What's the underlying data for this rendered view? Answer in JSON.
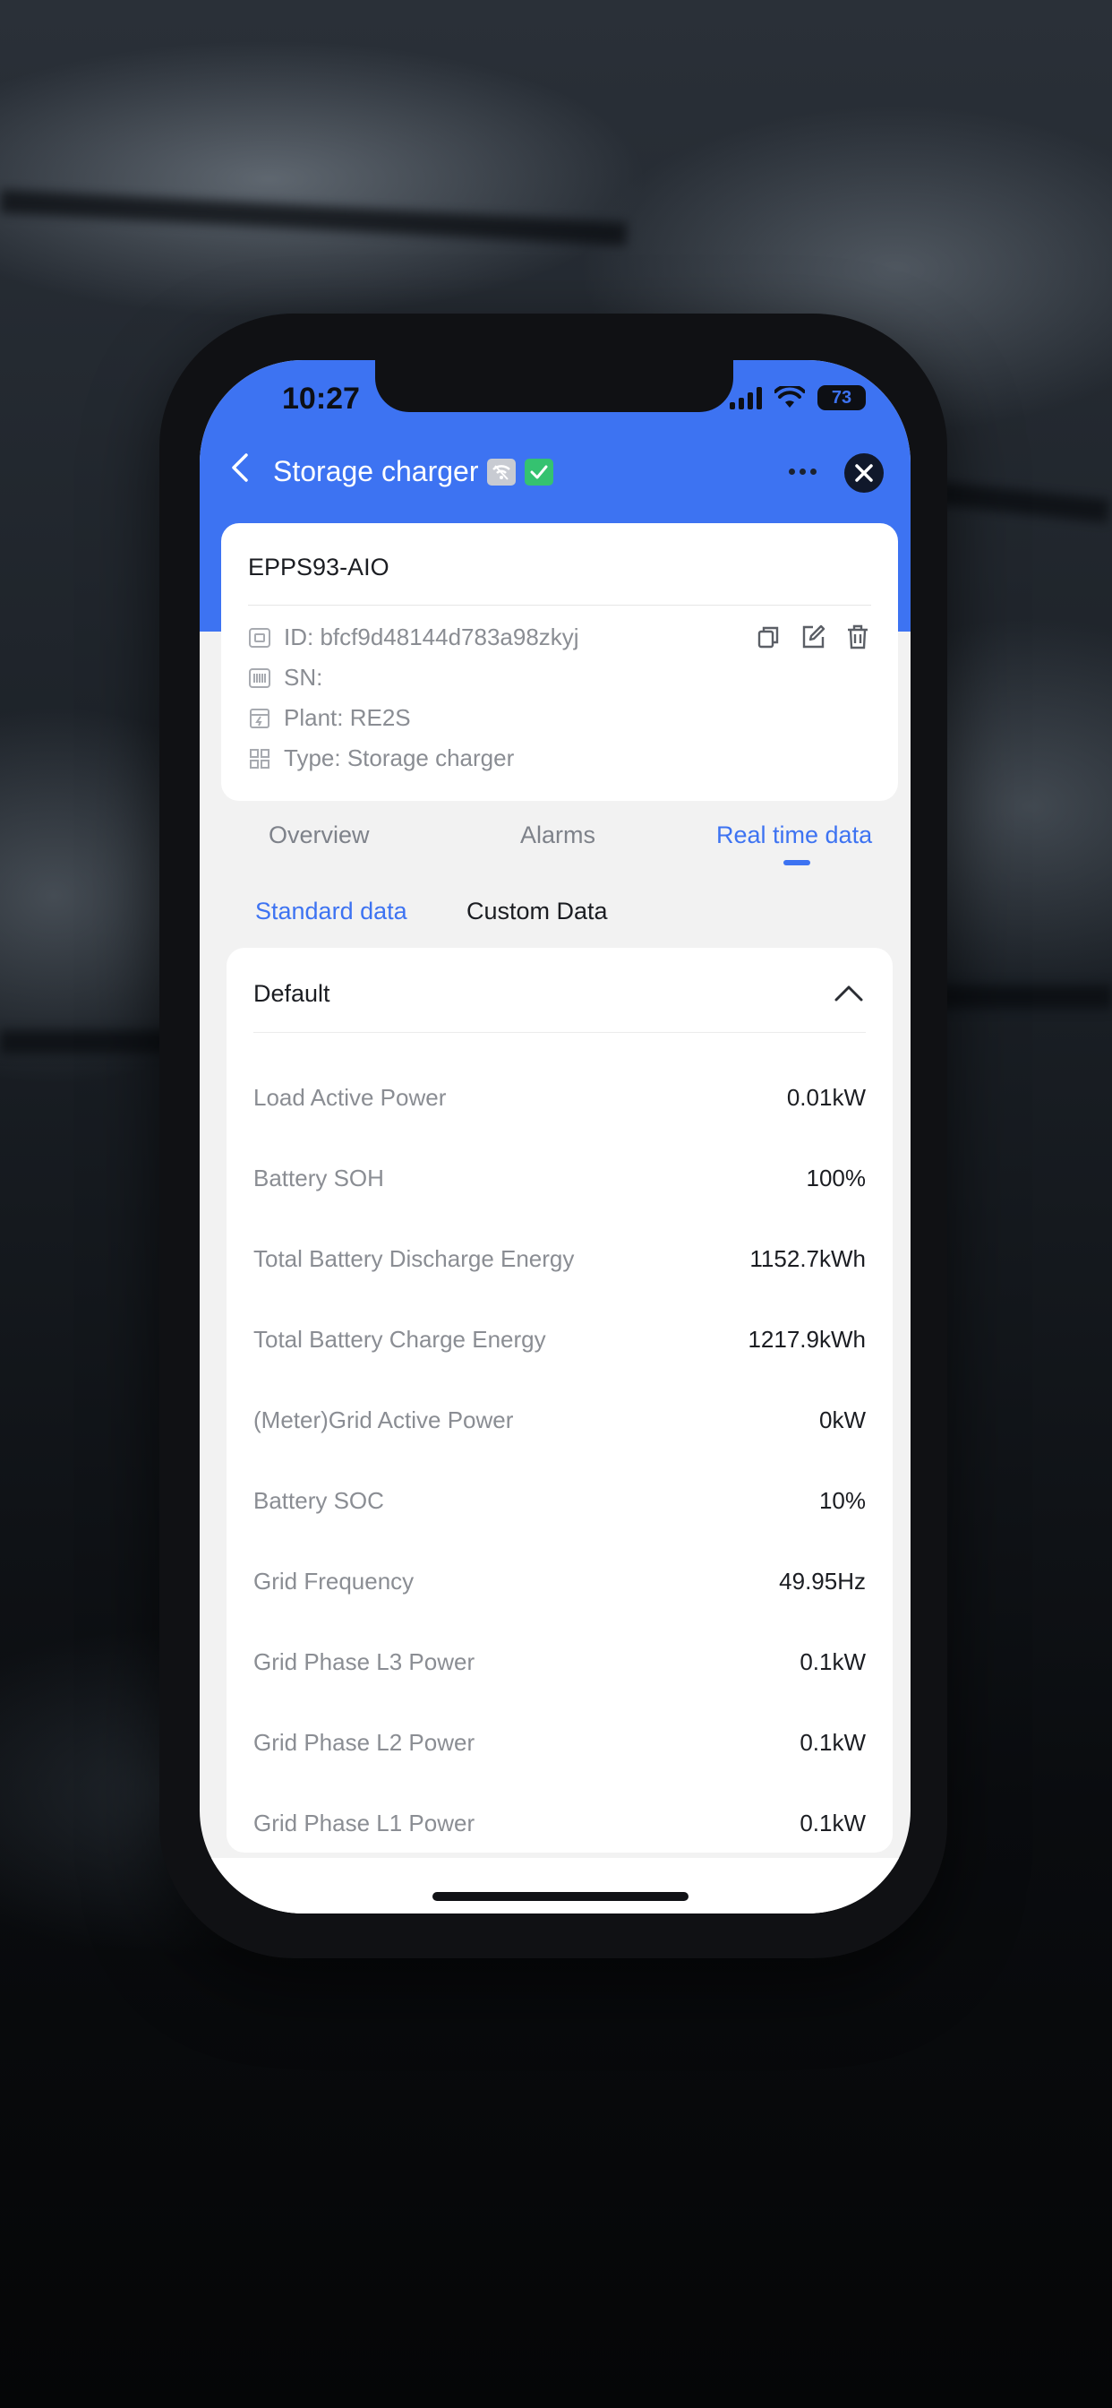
{
  "status_bar": {
    "time": "10:27",
    "battery": "73"
  },
  "nav": {
    "title": "Storage charger",
    "wifi_badge_icon": "wifi-off-icon",
    "status_badge_icon": "check-icon"
  },
  "device": {
    "name": "EPPS93-AIO",
    "id": "ID: bfcf9d48144d783a98zkyj",
    "sn": "SN:",
    "plant": "Plant: RE2S",
    "type": "Type: Storage charger"
  },
  "tabs": [
    {
      "label": "Overview",
      "active": false
    },
    {
      "label": "Alarms",
      "active": false
    },
    {
      "label": "Real time data",
      "active": true
    }
  ],
  "subtabs": [
    {
      "label": "Standard data",
      "active": true
    },
    {
      "label": "Custom Data",
      "active": false
    }
  ],
  "section": {
    "title": "Default",
    "rows": [
      {
        "label": "Load Active Power",
        "value": "0.01kW"
      },
      {
        "label": "Battery SOH",
        "value": "100%"
      },
      {
        "label": "Total Battery Discharge Energy",
        "value": "1152.7kWh"
      },
      {
        "label": "Total Battery Charge Energy",
        "value": "1217.9kWh"
      },
      {
        "label": "(Meter)Grid Active Power",
        "value": "0kW"
      },
      {
        "label": "Battery SOC",
        "value": "10%"
      },
      {
        "label": "Grid Frequency",
        "value": "49.95Hz"
      },
      {
        "label": "Grid Phase L3 Power",
        "value": "0.1kW"
      },
      {
        "label": "Grid Phase L2 Power",
        "value": "0.1kW"
      },
      {
        "label": "Grid Phase L1 Power",
        "value": "0.1kW"
      }
    ]
  },
  "colors": {
    "accent": "#3d73f2",
    "success": "#35c270"
  }
}
